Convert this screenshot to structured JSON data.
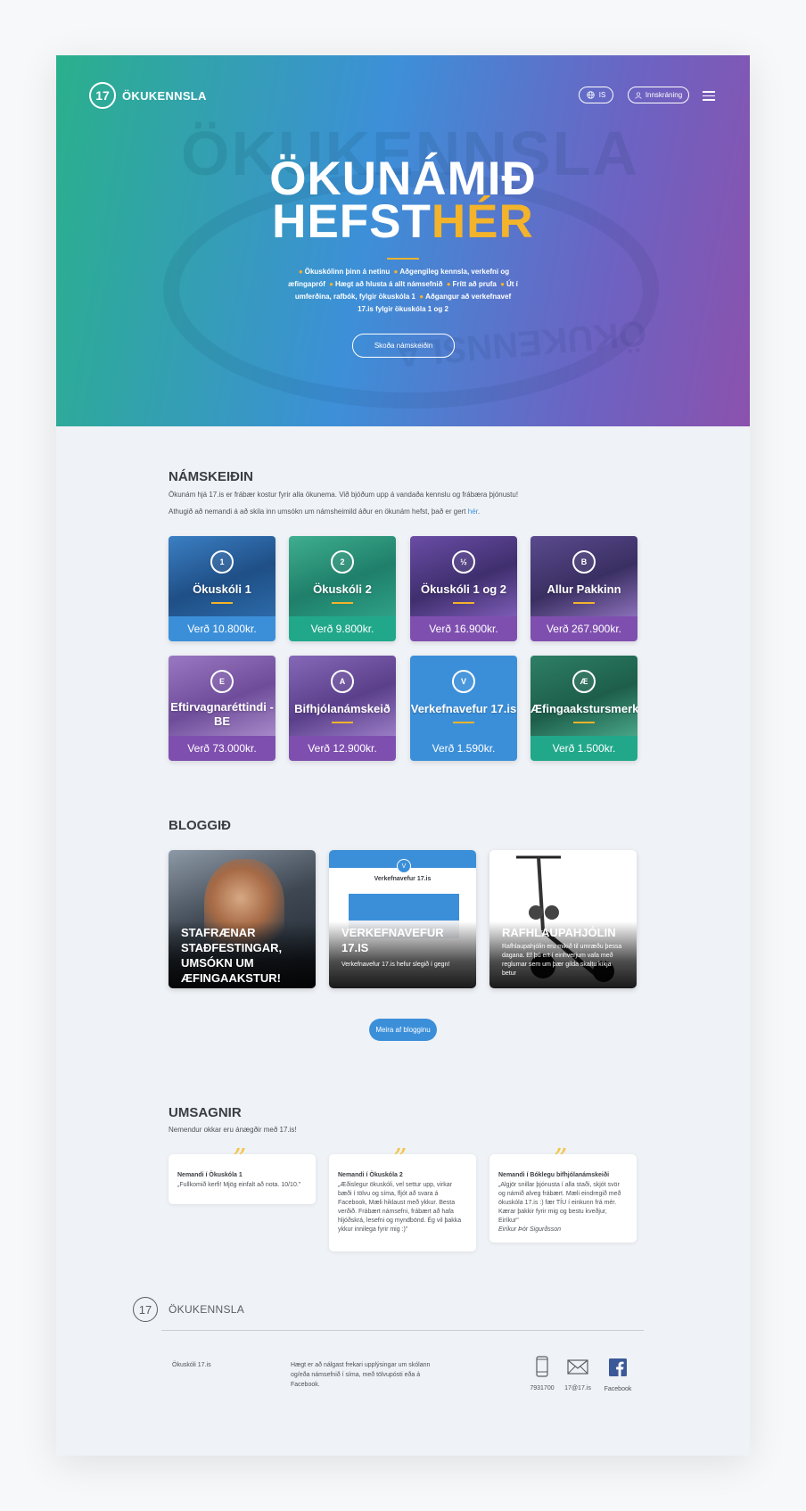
{
  "header": {
    "logo_mark": "17",
    "logo_text": "ÖKUKENNSLA",
    "lang_label": "IS",
    "login_label": "Innskráning"
  },
  "hero": {
    "bg_word": "ÖKUKENNSLA",
    "title_line1": "ÖKUNÁMIÐ",
    "title_line2a": "HEFST",
    "title_line2b": "HÉR",
    "features": [
      "Ökuskólinn þinn á netinu",
      "Aðgengileg kennsla, verkefni og æfingapróf",
      "Hægt að hlusta á allt námsefnið",
      "Frítt að prufa",
      "Út í umferðina, rafbók, fylgir ökuskóla 1",
      "Aðgangur að verkefnavef 17.is fylgir ökuskóla 1 og 2"
    ],
    "cta_label": "Skoða námskeiðin",
    "accent_color": "#f3b32b"
  },
  "courses": {
    "title": "NÁMSKEIÐIN",
    "intro": "Ökunám hjá 17.is er frábær kostur fyrir alla ökunema. Við bjóðum upp á vandaða kennslu og frábæra þjónustu!",
    "note_before": "Athugið að nemandi á að skila inn umsókn um námsheimild áður en ökunám hefst, það er gert ",
    "note_link": "hér",
    "note_after": ".",
    "items": [
      {
        "badge": "1",
        "title": "Ökuskóli 1",
        "price": "Verð 10.800kr."
      },
      {
        "badge": "2",
        "title": "Ökuskóli 2",
        "price": "Verð 9.800kr."
      },
      {
        "badge": "½",
        "title": "Ökuskóli 1 og 2",
        "price": "Verð 16.900kr."
      },
      {
        "badge": "B",
        "title": "Allur Pakkinn",
        "price": "Verð 267.900kr."
      },
      {
        "badge": "E",
        "title": "Eftirvagnaréttindi - BE",
        "price": "Verð 73.000kr."
      },
      {
        "badge": "A",
        "title": "Bifhjólanámskeið",
        "price": "Verð 12.900kr."
      },
      {
        "badge": "V",
        "title": "Verkefnavefur 17.is",
        "price": "Verð 1.590kr."
      },
      {
        "badge": "Æ",
        "title": "Æfingaakstursmerki",
        "price": "Verð 1.500kr."
      }
    ]
  },
  "blog": {
    "title": "BLOGGIÐ",
    "posts": [
      {
        "title": "STAFRÆNAR STAÐFESTINGAR, UMSÓKN UM ÆFINGAAKSTUR!",
        "excerpt": ""
      },
      {
        "title": "VERKEFNAVEFUR 17.IS",
        "excerpt": "Verkefnavefur 17.is hefur slegið í gegn!",
        "screen_title": "Verkefnavefur 17.is",
        "screen_badge": "V"
      },
      {
        "title": "RAFHLAUPAHJÓLIN",
        "excerpt": "Rafhlaupahjólin eru mikið til umræðu þessa dagana. Ef þú ert í einhverjum vafa með reglurnar sem um þær gilda skaltu kíkja betur"
      }
    ],
    "more_label": "Meira af blogginu"
  },
  "testimonials": {
    "title": "UMSAGNIR",
    "subtitle": "Nemendur okkar eru ánægðir með 17.is!",
    "items": [
      {
        "name": "Nemandi í Ökuskóla 1",
        "text": "„Fullkomið kerfi! Mjög einfalt að nota. 10/10.\"",
        "signature": ""
      },
      {
        "name": "Nemandi í Ökuskóla 2",
        "text": "„Æðislegur ökuskóli, vel settur upp, virkar bæði í tölvu og síma, fljót að svara á Facebook, Mæli hiklaust með ykkur. Besta verðið. Frábært námsefni, frábært að hafa hljóðskrá, lesefni og myndbönd. Ég vil þakka ykkur innilega fyrir mig :)\"",
        "signature": ""
      },
      {
        "name": "Nemandi í Bóklegu bifhjólanámskeiði",
        "text": "„Algjör snillar þjónusta í alla staði, skjót svör og námið alveg frábært. Mæli eindregið með ökuskóla 17.is :) fær TÍU í einkunn frá mér. Kærar þakkir fyrir mig og bestu kveðjur, Eiríkur\"",
        "signature": "Eiríkur Þór Sigurðsson"
      }
    ]
  },
  "footer": {
    "logo_mark": "17",
    "name": "ÖKUKENNSLA",
    "company": "Ökuskóli 17.is",
    "info": "Hægt er að nálgast frekari upplýsingar um skólann og/eða námsefnið í síma, með tölvupósti eða á Facebook.",
    "contacts": [
      {
        "icon": "phone-icon",
        "label": "7931700"
      },
      {
        "icon": "mail-icon",
        "label": "17@17.is"
      },
      {
        "icon": "facebook-icon",
        "label": "Facebook"
      }
    ],
    "facebook_color": "#3b5998"
  }
}
